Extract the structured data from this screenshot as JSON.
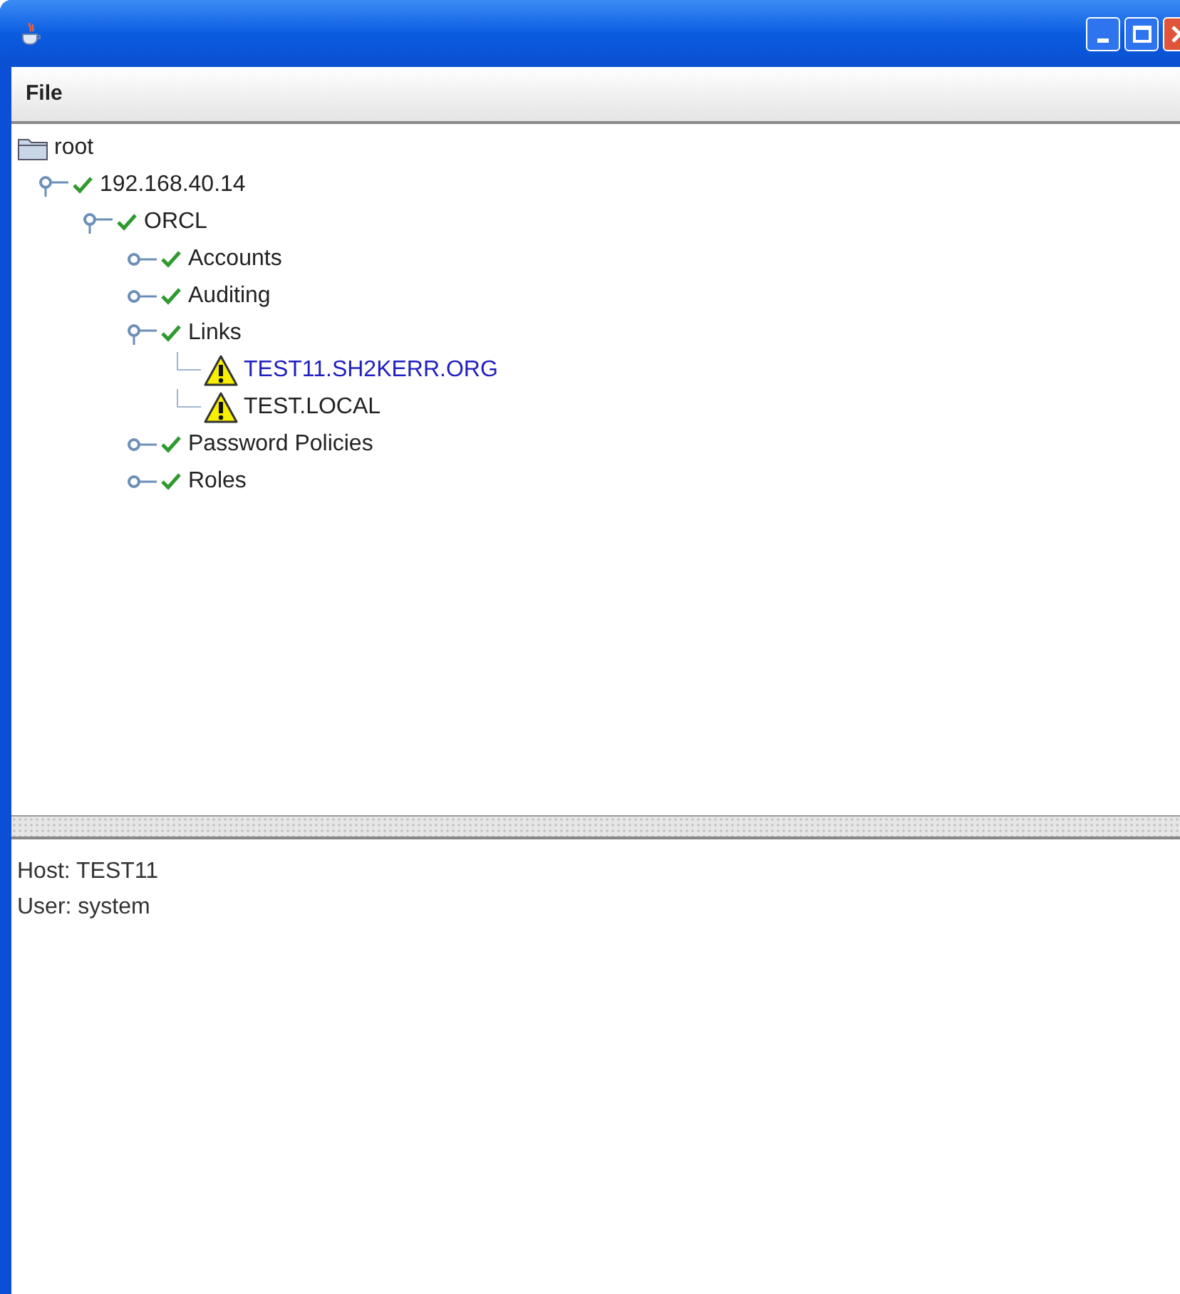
{
  "menu": [
    "File"
  ],
  "tree": [
    {
      "label": "root",
      "kind": "folder",
      "selected": false,
      "expanded": true,
      "children": [
        {
          "label": "192.168.40.14",
          "kind": "ok",
          "selected": false,
          "expanded": true,
          "children": [
            {
              "label": "ORCL",
              "kind": "ok",
              "selected": false,
              "expanded": true,
              "children": [
                {
                  "label": "Accounts",
                  "kind": "ok",
                  "selected": false,
                  "expanded": false
                },
                {
                  "label": "Auditing",
                  "kind": "ok",
                  "selected": false,
                  "expanded": false
                },
                {
                  "label": "Links",
                  "kind": "ok",
                  "selected": false,
                  "expanded": true,
                  "children": [
                    {
                      "label": "TEST11.SH2KERR.ORG",
                      "kind": "warning",
                      "selected": true
                    },
                    {
                      "label": "TEST.LOCAL",
                      "kind": "warning",
                      "selected": false
                    }
                  ]
                },
                {
                  "label": "Password Policies",
                  "kind": "ok",
                  "selected": false,
                  "expanded": false
                },
                {
                  "label": "Roles",
                  "kind": "ok",
                  "selected": false,
                  "expanded": false
                }
              ]
            }
          ]
        }
      ]
    }
  ],
  "details": [
    "Host: TEST11",
    "User: system"
  ]
}
